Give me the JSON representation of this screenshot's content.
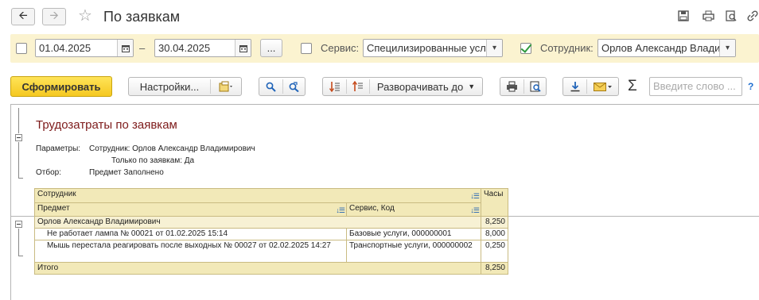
{
  "window": {
    "title": "По заявкам"
  },
  "filters": {
    "date_from": "01.04.2025",
    "date_dash": "–",
    "date_to": "30.04.2025",
    "period_button": "...",
    "service_label": "Сервис:",
    "service_value": "Специлизированные усл",
    "service_checked": false,
    "employee_label": "Сотрудник:",
    "employee_value": "Орлов Александр Влади",
    "employee_checked": true,
    "period_checked": false
  },
  "toolbar": {
    "generate_label": "Сформировать",
    "settings_label": "Настройки...",
    "expand_label": "Разворачивать до",
    "search_placeholder": "Введите слово ...",
    "sigma": "Σ",
    "help": "?"
  },
  "report": {
    "title": "Трудозатраты по заявкам",
    "params_label": "Параметры:",
    "param_1": "Сотрудник: Орлов Александр Владимирович",
    "param_2": "Только по заявкам: Да",
    "filter_label": "Отбор:",
    "filter_value": "Предмет Заполнено",
    "headers": {
      "employee": "Сотрудник",
      "subject": "Предмет",
      "service": "Сервис, Код",
      "hours": "Часы"
    },
    "group": {
      "name": "Орлов Александр Владимирович",
      "hours": "8,250"
    },
    "rows": [
      {
        "subject": "Не работает лампа № 00021 от 01.02.2025 15:14",
        "service": "Базовые услуги, 000000001",
        "hours": "8,000"
      },
      {
        "subject": "Мышь перестала реагировать после выходных № 00027 от 02.02.2025 14:27",
        "service": "Транспортные услуги, 000000002",
        "hours": "0,250"
      }
    ],
    "total": {
      "label": "Итого",
      "hours": "8,250"
    }
  }
}
